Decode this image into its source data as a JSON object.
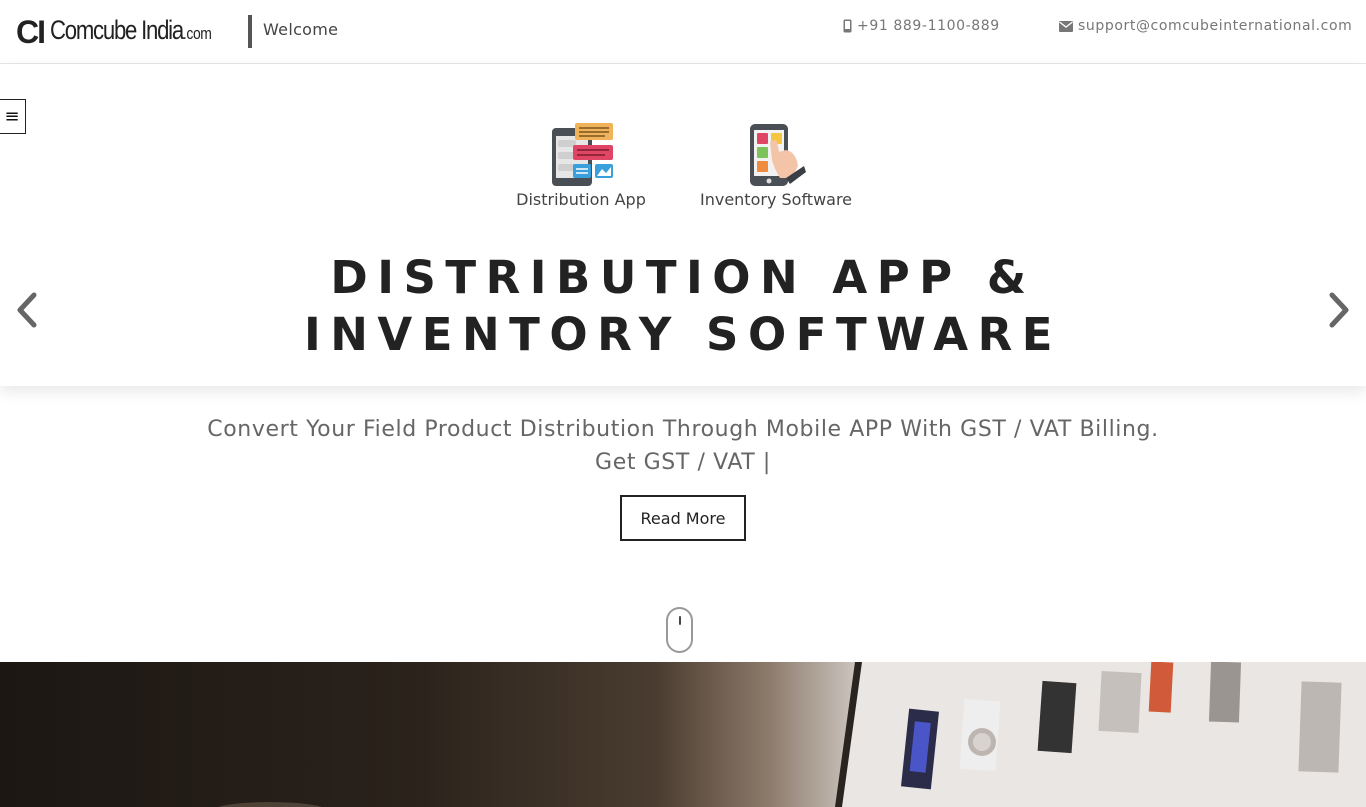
{
  "header": {
    "logo_mark": "CI",
    "logo_name": "Comcube India",
    "logo_suffix": ".com",
    "welcome": "Welcome",
    "phone": "+91 889-1100-889",
    "email": "support@comcubeinternational.com"
  },
  "menu": {
    "icon": "≡"
  },
  "hero": {
    "products": [
      {
        "label": "Distribution App",
        "icon": "distribution-app-icon"
      },
      {
        "label": "Inventory Software",
        "icon": "inventory-software-icon"
      }
    ],
    "title_line1": "DISTRIBUTION APP &",
    "title_line2": "INVENTORY SOFTWARE",
    "tagline_line1": "Convert Your Field Product Distribution Through Mobile APP With GST / VAT Billing.",
    "tagline_line2": "Get GST / VAT |",
    "read_more": "Read More"
  },
  "colors": {
    "text_dark": "#222222",
    "text_muted": "#666666",
    "border": "#222222"
  }
}
